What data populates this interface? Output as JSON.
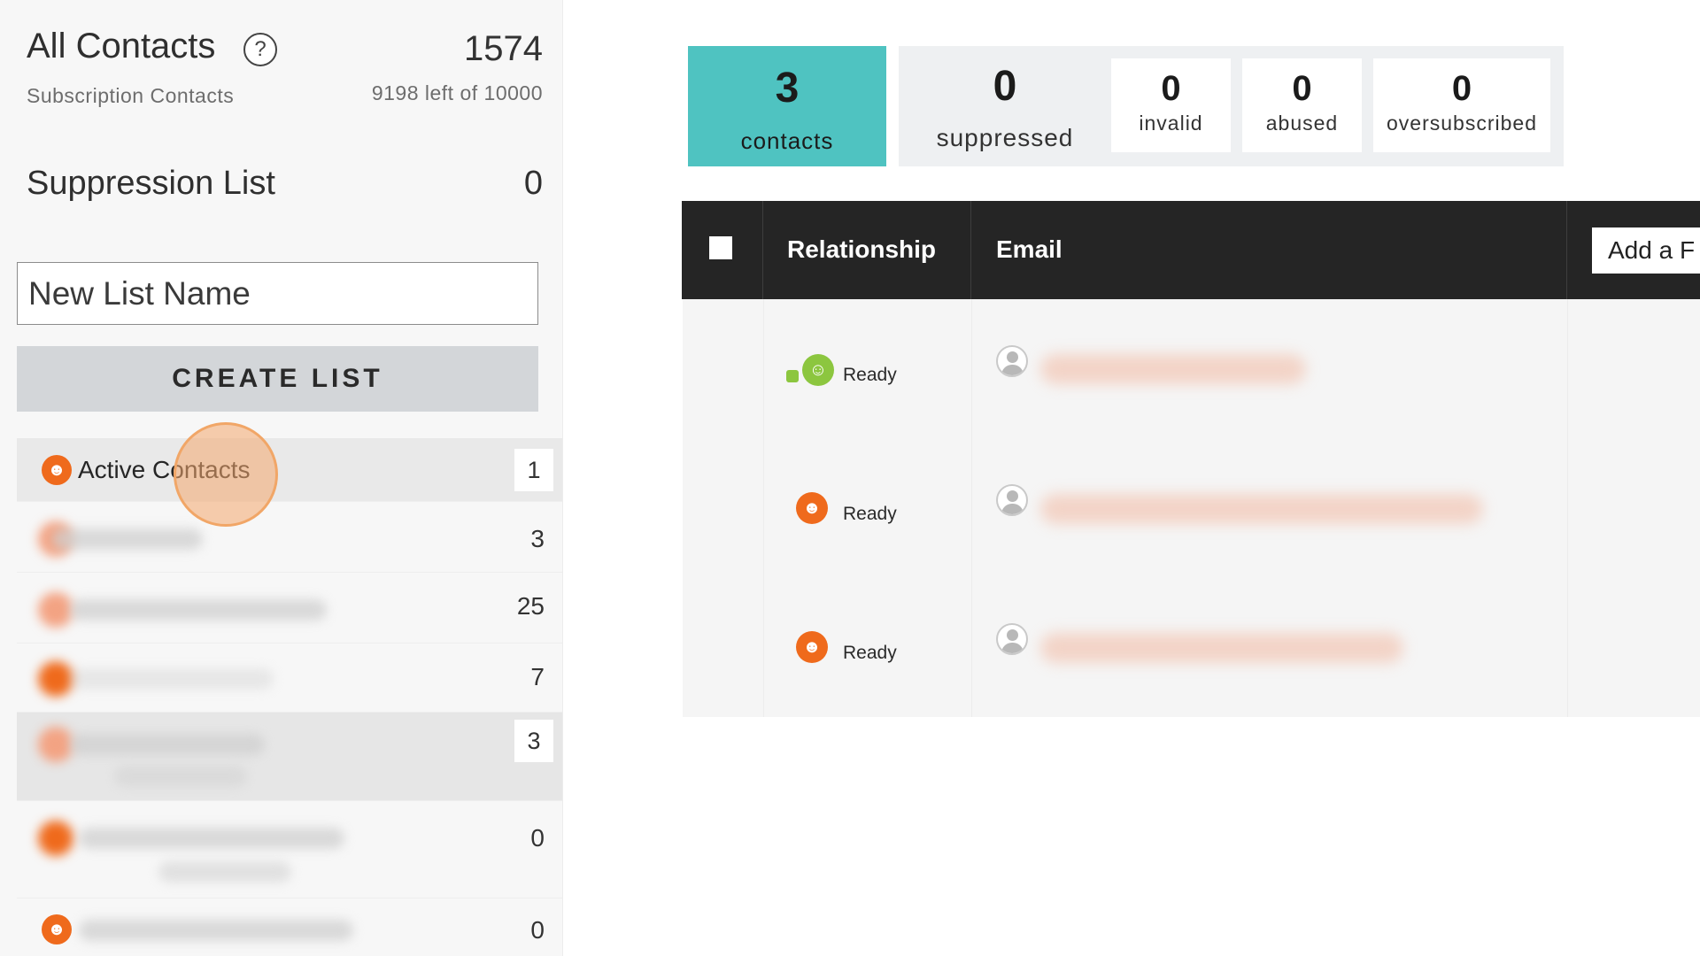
{
  "sidebar": {
    "all_contacts": {
      "title": "All Contacts",
      "help": "?",
      "count": "1574",
      "subtitle": "Subscription Contacts",
      "remaining": "9198 left of 10000"
    },
    "suppression": {
      "title": "Suppression List",
      "count": "0"
    },
    "new_list": {
      "placeholder": "New List Name",
      "button": "CREATE LIST"
    },
    "lists": [
      {
        "name": "Active Contacts",
        "count": "1"
      },
      {
        "name": "",
        "count": "3"
      },
      {
        "name": "",
        "count": "25"
      },
      {
        "name": "",
        "count": "7"
      },
      {
        "name": "",
        "count": "3"
      },
      {
        "name": "",
        "count": "0"
      },
      {
        "name": "",
        "count": "0"
      }
    ]
  },
  "stats": {
    "contacts": {
      "value": "3",
      "label": "contacts"
    },
    "suppressed": {
      "value": "0",
      "label": "suppressed"
    },
    "invalid": {
      "value": "0",
      "label": "invalid"
    },
    "abused": {
      "value": "0",
      "label": "abused"
    },
    "oversubscribed": {
      "value": "0",
      "label": "oversubscribed"
    }
  },
  "table": {
    "headers": {
      "relationship": "Relationship",
      "email": "Email",
      "add_field": "Add a F"
    },
    "rows": [
      {
        "status": "Ready",
        "icon": "happy-face-icon"
      },
      {
        "status": "Ready",
        "icon": "neutral-face-icon"
      },
      {
        "status": "Ready",
        "icon": "neutral-face-icon"
      }
    ]
  },
  "colors": {
    "accent_teal": "#4fc3c1",
    "header_dark": "#252525",
    "status_orange": "#ef6a1c",
    "status_green": "#8cc63f"
  }
}
